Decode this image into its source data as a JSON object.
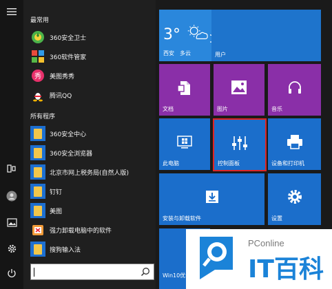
{
  "rail": {
    "icons": [
      "hamburger-menu-icon",
      "tablet-mode-icon",
      "user-avatar-icon",
      "pictures-icon",
      "settings-gear-icon",
      "power-icon"
    ]
  },
  "app_list": {
    "most_used_header": "最常用",
    "most_used": [
      {
        "label": "360安全卫士",
        "icon": "360-security-icon"
      },
      {
        "label": "360软件管家",
        "icon": "360-software-manager-icon"
      },
      {
        "label": "美图秀秀",
        "icon": "meitu-xiuxiu-icon"
      },
      {
        "label": "腾讯QQ",
        "icon": "qq-penguin-icon"
      }
    ],
    "all_apps_header": "所有程序",
    "all_apps": [
      {
        "label": "360安全中心",
        "icon": "folder-icon",
        "expandable": true
      },
      {
        "label": "360安全浏览器",
        "icon": "folder-icon",
        "expandable": true
      },
      {
        "label": "北京市网上税务局(自然人版)",
        "icon": "folder-icon",
        "expandable": true
      },
      {
        "label": "钉钉",
        "icon": "folder-icon",
        "expandable": true
      },
      {
        "label": "美图",
        "icon": "folder-icon",
        "expandable": true
      },
      {
        "label": "强力卸载电脑中的软件",
        "icon": "uninstall-icon",
        "expandable": false
      },
      {
        "label": "搜狗输入法",
        "icon": "folder-icon",
        "expandable": true
      }
    ]
  },
  "search": {
    "placeholder": ""
  },
  "tiles": {
    "weather": {
      "temp": "3°",
      "city": "西安",
      "condition": "多云"
    },
    "user": {
      "label": "用户"
    },
    "documents": {
      "label": "文档"
    },
    "pictures": {
      "label": "图片"
    },
    "music": {
      "label": "音乐"
    },
    "this_pc": {
      "label": "此电脑"
    },
    "control_panel": {
      "label": "控制面板"
    },
    "devices_printers": {
      "label": "设备和打印机"
    },
    "install_uninstall": {
      "label": "安装与卸载软件"
    },
    "settings": {
      "label": "设置"
    },
    "win10": {
      "label": "Win10优化"
    }
  },
  "watermark": {
    "brand_small": "PConline",
    "brand_large": "IT百科"
  },
  "colors": {
    "tile_blue": "#1e7fd8",
    "tile_purple": "#8a2fa8",
    "tile_dark_blue": "#1b5fb3",
    "highlight_red": "#e02424"
  }
}
